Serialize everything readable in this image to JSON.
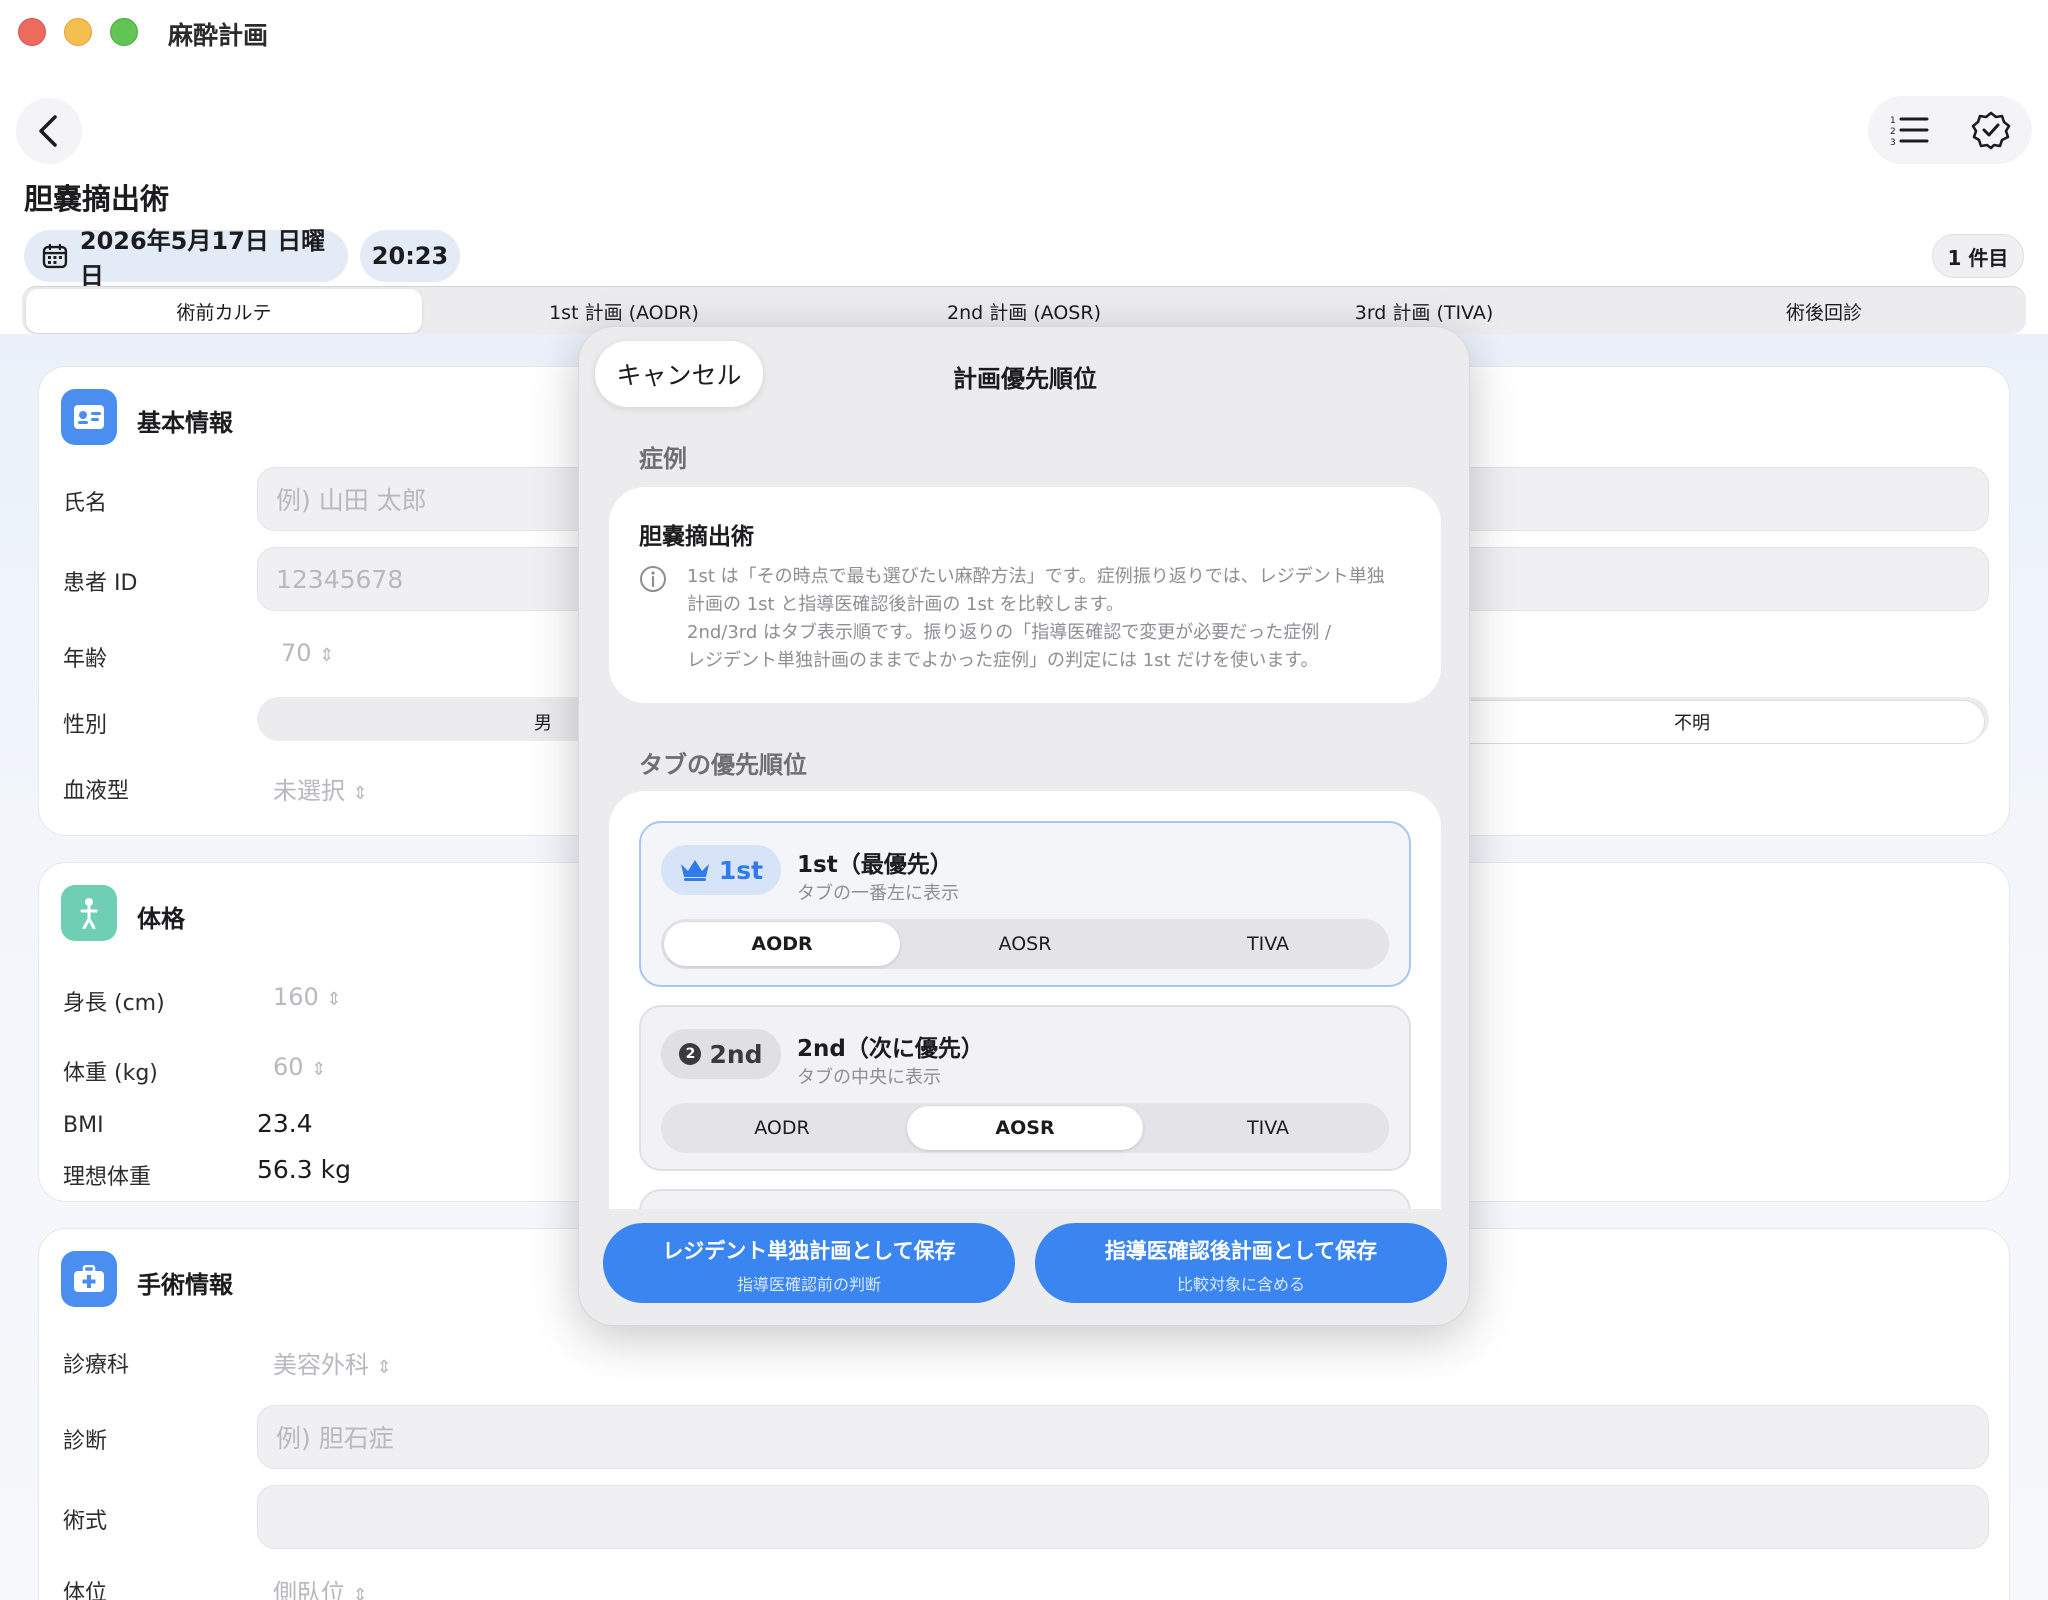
{
  "window": {
    "title": "麻酔計画"
  },
  "header": {
    "page_title": "胆嚢摘出術",
    "date": "2026年5月17日 日曜日",
    "time": "20:23",
    "count": "1 件目"
  },
  "tabs": [
    {
      "label": "術前カルテ"
    },
    {
      "label": "1st 計画 (AODR)"
    },
    {
      "label": "2nd 計画 (AOSR)"
    },
    {
      "label": "3rd 計画 (TIVA)"
    },
    {
      "label": "術後回診"
    }
  ],
  "basic": {
    "title": "基本情報",
    "name_label": "氏名",
    "name_placeholder": "例) 山田 太郎",
    "id_label": "患者 ID",
    "id_placeholder": "12345678",
    "age_label": "年齢",
    "age_value": "70",
    "sex_label": "性別",
    "sex_options": [
      "男",
      "不明"
    ],
    "blood_label": "血液型",
    "blood_value": "未選択"
  },
  "body": {
    "title": "体格",
    "height_label": "身長 (cm)",
    "height_value": "160",
    "weight_label": "体重 (kg)",
    "weight_value": "60",
    "bmi_label": "BMI",
    "bmi_value": "23.4",
    "ibw_label": "理想体重",
    "ibw_value": "56.3 kg"
  },
  "surgery": {
    "title": "手術情報",
    "dept_label": "診療科",
    "dept_value": "美容外科",
    "diag_label": "診断",
    "diag_placeholder": "例) 胆石症",
    "proc_label": "術式",
    "pos_label": "体位",
    "pos_value": "側臥位"
  },
  "modal": {
    "cancel": "キャンセル",
    "title": "計画優先順位",
    "case_section": "症例",
    "case_name": "胆嚢摘出術",
    "info_lines": [
      "1st は「その時点で最も選びたい麻酔方法」です。症例振り返りでは、レジデント単独",
      "計画の 1st と指導医確認後計画の 1st を比較します。",
      "2nd/3rd はタブ表示順です。振り返りの「指導医確認で変更が必要だった症例 /",
      "レジデント単独計画のままでよかった症例」の判定には 1st だけを使います。"
    ],
    "tab_section": "タブの優先順位",
    "first": {
      "badge": "1st",
      "name": "1st（最優先）",
      "sub": "タブの一番左に表示",
      "options": [
        "AODR",
        "AOSR",
        "TIVA"
      ],
      "selected": "AODR"
    },
    "second": {
      "badge_num": "2",
      "badge": "2nd",
      "name": "2nd（次に優先）",
      "sub": "タブの中央に表示",
      "options": [
        "AODR",
        "AOSR",
        "TIVA"
      ],
      "selected": "AOSR"
    },
    "save_resident": {
      "label": "レジデント単独計画として保存",
      "sub": "指導医確認前の判断"
    },
    "save_supervisor": {
      "label": "指導医確認後計画として保存",
      "sub": "比較対象に含める"
    }
  },
  "colors": {
    "accent": "#3a85f0",
    "badge_blue": "#2f7bea",
    "body_icon": "#6fcfb5",
    "card_icon": "#4a8ff0"
  }
}
